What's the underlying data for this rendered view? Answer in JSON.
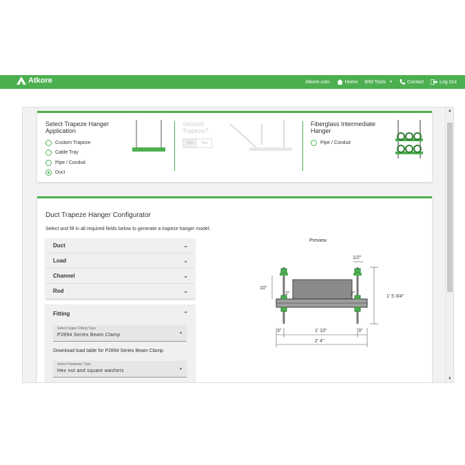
{
  "header": {
    "brand": "Atkore",
    "nav": [
      {
        "label": "Atkore.com",
        "icon": ""
      },
      {
        "label": "Home",
        "icon": "home-icon"
      },
      {
        "label": "BIM Tools",
        "icon": "",
        "dropdown": true
      },
      {
        "label": "Contact",
        "icon": "phone-icon"
      },
      {
        "label": "Log Out",
        "icon": "logout-icon"
      }
    ],
    "accent_color": "#4caf50"
  },
  "applications": {
    "col1": {
      "title": "Select Trapeze Hanger Application",
      "options": [
        {
          "label": "Custom Trapeze",
          "checked": false
        },
        {
          "label": "Cable Tray",
          "checked": false
        },
        {
          "label": "Pipe / Conduit",
          "checked": false
        },
        {
          "label": "Duct",
          "checked": true
        }
      ]
    },
    "col2": {
      "title": "Seismic Trapeze?",
      "toggle_no": "No",
      "toggle_yes": "Yes",
      "disabled": true
    },
    "col3": {
      "title": "Fiberglass Intermediate Hanger",
      "options": [
        {
          "label": "Pipe / Conduit",
          "checked": false
        }
      ]
    }
  },
  "configurator": {
    "title": "Duct Trapeze Hanger Configurator",
    "subtitle": "Select and fill in all required fields below to generate a trapeze hanger model:",
    "sections": [
      "Duct",
      "Load",
      "Channel",
      "Rod"
    ],
    "fitting": {
      "label": "Fitting",
      "upper_fitting_label": "Select Upper Fitting Type",
      "upper_fitting_value": "P2894 Series Beam Clamp",
      "download_text": "Download load table for P2894 Series Beam Clamp",
      "hardware_label": "Select Hardware Type",
      "hardware_value": "Hex nut and square washers"
    },
    "preview": {
      "label": "Preview",
      "dims": {
        "rod_diameter": "1/2\"",
        "left_height": "10\"",
        "total_height": "1' 5 3/4\"",
        "left_gap": "2\"",
        "right_gap": "2\"",
        "left_overhang": "3\"",
        "inner_width": "1' 10\"",
        "right_overhang": "3\"",
        "total_width": "2' 4\""
      }
    }
  }
}
